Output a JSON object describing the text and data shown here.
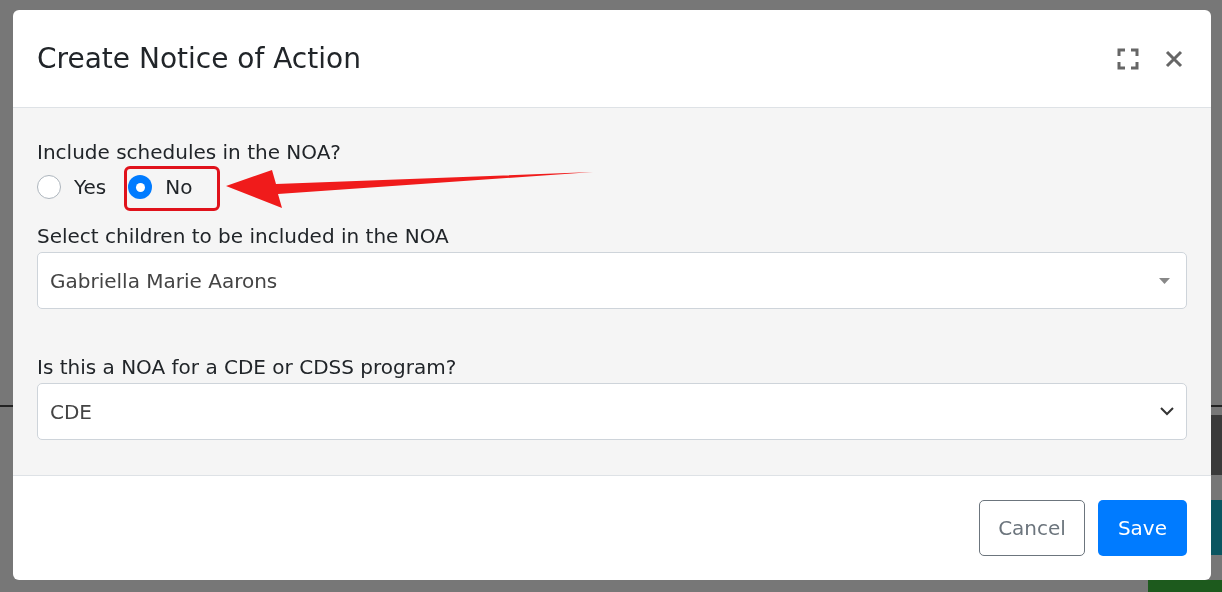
{
  "dialog": {
    "title": "Create Notice of Action"
  },
  "fields": [
    {
      "kind": "radio",
      "label": "Include schedules in the NOA?",
      "options": [
        {
          "label": "Yes",
          "selected": false
        },
        {
          "label": "No",
          "selected": true
        }
      ]
    },
    {
      "kind": "combobox",
      "label": "Select children to be included in the NOA",
      "value": "Gabriella Marie Aarons"
    },
    {
      "kind": "select",
      "label": "Is this a NOA for a CDE or CDSS program?",
      "value": "CDE"
    }
  ],
  "buttons": [
    {
      "kind": "secondary",
      "label": "Cancel"
    },
    {
      "kind": "primary",
      "label": "Save"
    }
  ]
}
